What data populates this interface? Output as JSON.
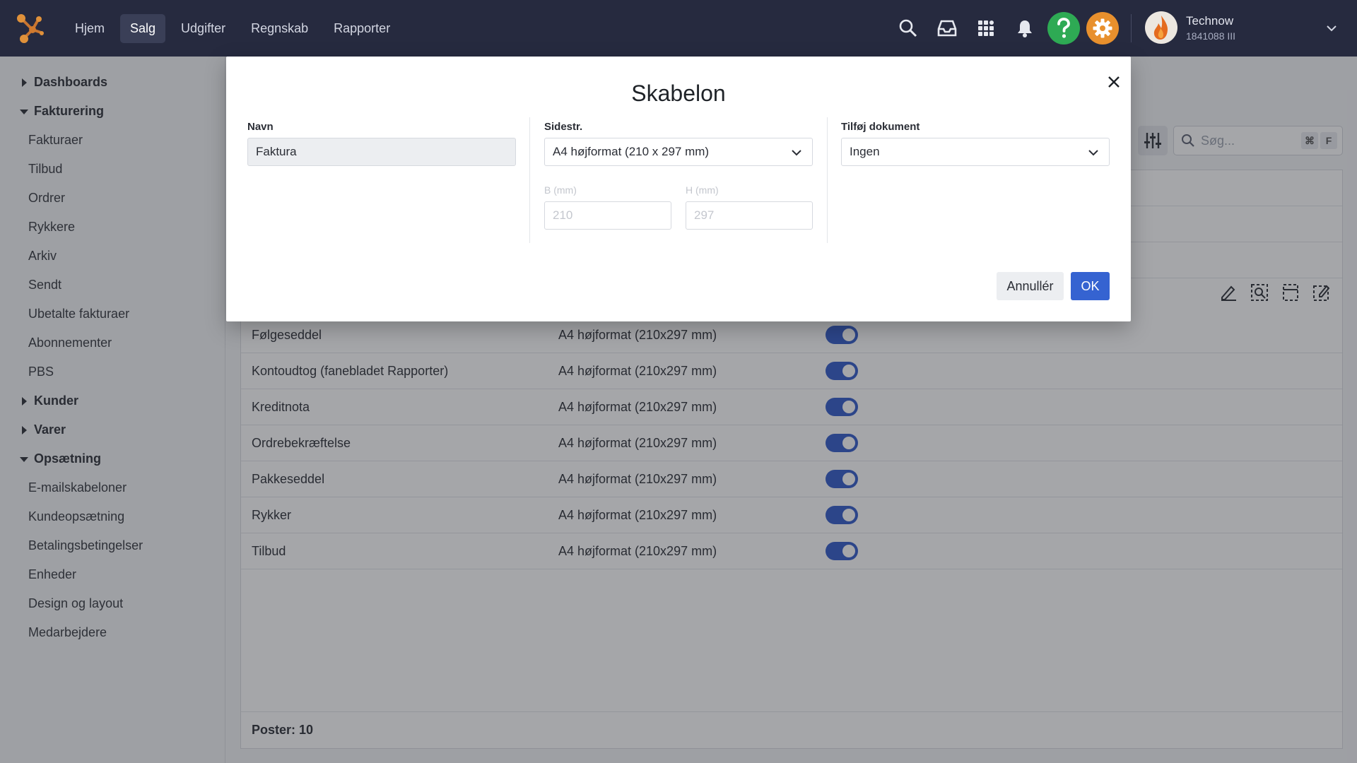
{
  "topbar": {
    "nav": [
      "Hjem",
      "Salg",
      "Udgifter",
      "Regnskab",
      "Rapporter"
    ],
    "active_nav": "Salg",
    "user_name": "Technow",
    "user_id": "1841088 III"
  },
  "sidebar": {
    "groups": [
      {
        "label": "Dashboards",
        "expanded": false,
        "items": []
      },
      {
        "label": "Fakturering",
        "expanded": true,
        "items": [
          "Fakturaer",
          "Tilbud",
          "Ordrer",
          "Rykkere",
          "Arkiv",
          "Sendt",
          "Ubetalte fakturaer",
          "Abonnementer",
          "PBS"
        ]
      },
      {
        "label": "Kunder",
        "expanded": false,
        "items": []
      },
      {
        "label": "Varer",
        "expanded": false,
        "items": []
      },
      {
        "label": "Opsætning",
        "expanded": true,
        "items": [
          "E-mailskabeloner",
          "Kundeopsætning",
          "Betalingsbetingelser",
          "Enheder",
          "Design og layout",
          "Medarbejdere"
        ]
      }
    ]
  },
  "search": {
    "placeholder": "Søg...",
    "kbd1": "⌘",
    "kbd2": "F"
  },
  "table": {
    "rows": [
      {
        "name": "Følgeseddel",
        "format": "A4 højformat (210x297 mm)",
        "enabled": true
      },
      {
        "name": "Kontoudtog (fanebladet Rapporter)",
        "format": "A4 højformat (210x297 mm)",
        "enabled": true
      },
      {
        "name": "Kreditnota",
        "format": "A4 højformat (210x297 mm)",
        "enabled": true
      },
      {
        "name": "Ordrebekræftelse",
        "format": "A4 højformat (210x297 mm)",
        "enabled": true
      },
      {
        "name": "Pakkeseddel",
        "format": "A4 højformat (210x297 mm)",
        "enabled": true
      },
      {
        "name": "Rykker",
        "format": "A4 højformat (210x297 mm)",
        "enabled": true
      },
      {
        "name": "Tilbud",
        "format": "A4 højformat (210x297 mm)",
        "enabled": true
      }
    ],
    "footer": "Poster: 10"
  },
  "modal": {
    "title": "Skabelon",
    "name_label": "Navn",
    "name_value": "Faktura",
    "page_size_label": "Sidestr.",
    "page_size_value": "A4 højformat (210 x 297 mm)",
    "width_label": "B (mm)",
    "width_value": "210",
    "height_label": "H (mm)",
    "height_value": "297",
    "attach_label": "Tilføj dokument",
    "attach_value": "Ingen",
    "cancel_label": "Annullér",
    "ok_label": "OK"
  },
  "colors": {
    "topbar": "#262a3f",
    "accent": "#3563d1",
    "help": "#2eaa54",
    "settings": "#e8902d"
  }
}
